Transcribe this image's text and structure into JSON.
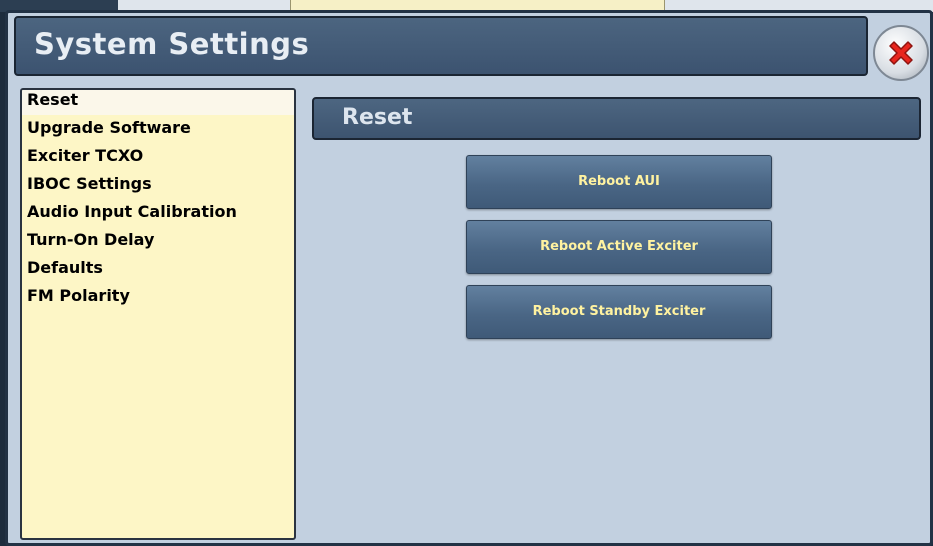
{
  "window": {
    "title": "System Settings"
  },
  "sidebar": {
    "items": [
      {
        "label": "Reset",
        "selected": true
      },
      {
        "label": "Upgrade Software",
        "selected": false
      },
      {
        "label": "Exciter TCXO",
        "selected": false
      },
      {
        "label": "IBOC Settings",
        "selected": false
      },
      {
        "label": "Audio Input Calibration",
        "selected": false
      },
      {
        "label": "Turn-On Delay",
        "selected": false
      },
      {
        "label": "Defaults",
        "selected": false
      },
      {
        "label": "FM Polarity",
        "selected": false
      }
    ]
  },
  "main": {
    "section_title": "Reset",
    "buttons": {
      "reboot_aui": "Reboot AUI",
      "reboot_active_exciter": "Reboot Active Exciter",
      "reboot_standby_exciter": "Reboot Standby Exciter"
    }
  },
  "icons": {
    "close": "close-icon"
  },
  "colors": {
    "title_bar": "#3f5772",
    "sidebar_bg": "#fdf6c6",
    "button_text": "#fff2a0",
    "close_red": "#e8261e"
  }
}
